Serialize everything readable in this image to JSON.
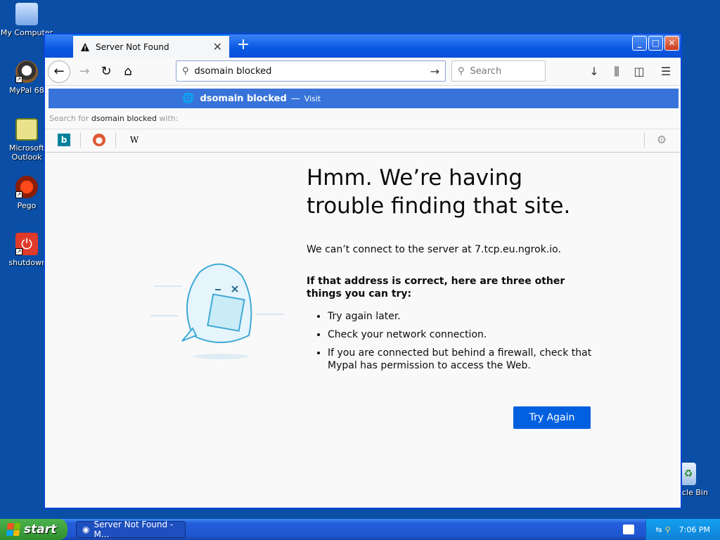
{
  "desktop": {
    "icons": [
      {
        "label": "My Computer"
      },
      {
        "label": "MyPal 68"
      },
      {
        "label": "Microsoft Outlook"
      },
      {
        "label": "Pego"
      },
      {
        "label": "shutdowr"
      },
      {
        "label": "cle Bin"
      }
    ]
  },
  "browser": {
    "tab_title": "Server Not Found",
    "url_value": "dsomain blocked",
    "search_placeholder": "Search",
    "suggestion": {
      "text": "dsomain blocked",
      "dash": "—",
      "action": "Visit"
    },
    "search_for_prefix": "Search for",
    "search_for_term": "dsomain blocked",
    "search_for_suffix": "with:"
  },
  "error_page": {
    "heading": "Hmm. We’re having trouble finding that site.",
    "message": "We can’t connect to the server at 7.tcp.eu.ngrok.io.",
    "subheading": "If that address is correct, here are three other things you can try:",
    "tips": [
      "Try again later.",
      "Check your network connection.",
      "If you are connected but behind a firewall, check that Mypal has permission to access the Web."
    ],
    "button": "Try Again"
  },
  "taskbar": {
    "start": "start",
    "task": "Server Not Found - M...",
    "clock": "7:06 PM"
  }
}
